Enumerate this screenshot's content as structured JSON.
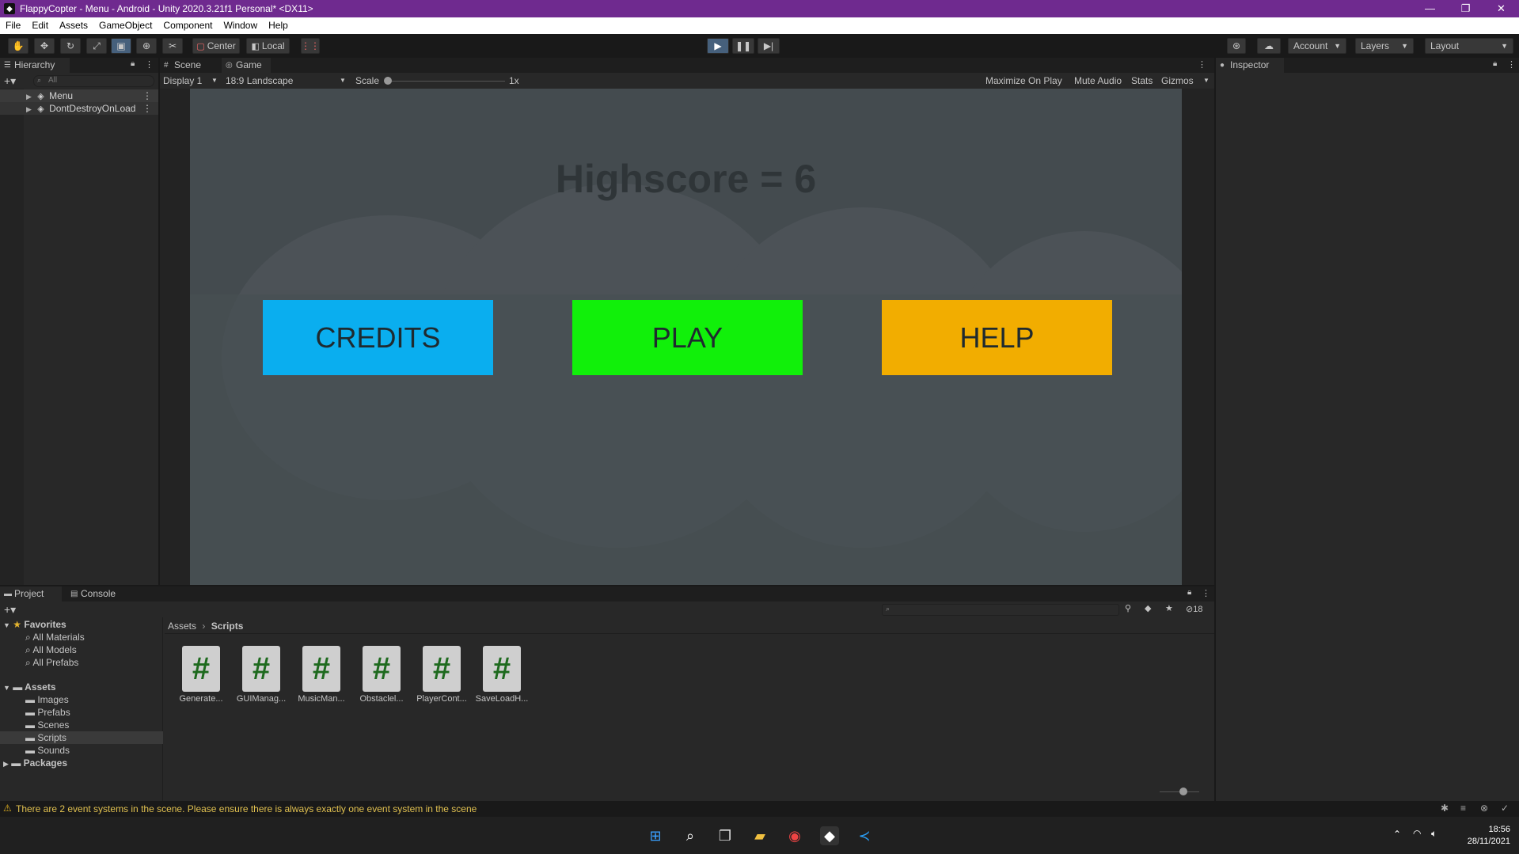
{
  "window": {
    "title": "FlappyCopter - Menu - Android - Unity 2020.3.21f1 Personal* <DX11>",
    "controls": [
      "—",
      "❐",
      "✕"
    ]
  },
  "menubar": [
    "File",
    "Edit",
    "Assets",
    "GameObject",
    "Component",
    "Window",
    "Help"
  ],
  "toolbar": {
    "pivot_label": "Center",
    "space_label": "Local",
    "account_label": "Account",
    "layers_label": "Layers",
    "layout_label": "Layout"
  },
  "hierarchy": {
    "tab_label": "Hierarchy",
    "search_placeholder": "All",
    "items": [
      {
        "label": "Menu"
      },
      {
        "label": "DontDestroyOnLoad"
      }
    ]
  },
  "gameview": {
    "tabs": [
      {
        "label": "Scene"
      },
      {
        "label": "Game"
      }
    ],
    "display": "Display 1",
    "aspect": "18:9 Landscape",
    "scale_label": "Scale",
    "scale_value": "1x",
    "options": [
      "Maximize On Play",
      "Mute Audio",
      "Stats",
      "Gizmos"
    ],
    "highscore_text": "Highscore = 6",
    "buttons": [
      {
        "label": "CREDITS",
        "color": "#0aaeef"
      },
      {
        "label": "PLAY",
        "color": "#11f00a"
      },
      {
        "label": "HELP",
        "color": "#f2ad00"
      }
    ]
  },
  "inspector": {
    "tab_label": "Inspector"
  },
  "project": {
    "tabs": [
      {
        "label": "Project"
      },
      {
        "label": "Console"
      }
    ],
    "hidden_count": "18",
    "favorites": {
      "label": "Favorites",
      "items": [
        "All Materials",
        "All Models",
        "All Prefabs"
      ]
    },
    "assets": {
      "label": "Assets",
      "items": [
        "Images",
        "Prefabs",
        "Scenes",
        "Scripts",
        "Sounds"
      ]
    },
    "packages_label": "Packages",
    "breadcrumb": [
      "Assets",
      "Scripts"
    ],
    "files": [
      {
        "label": "Generate..."
      },
      {
        "label": "GUIManag..."
      },
      {
        "label": "MusicMan..."
      },
      {
        "label": "Obstaclel..."
      },
      {
        "label": "PlayerCont..."
      },
      {
        "label": "SaveLoadH..."
      }
    ]
  },
  "statusbar": {
    "message": "There are 2 event systems in the scene. Please ensure there is always exactly one event system in the scene"
  },
  "taskbar": {
    "time": "18:56",
    "date": "28/11/2021"
  },
  "colors": {
    "titlebar": "#6f2a8f",
    "accent": "#46607c"
  }
}
